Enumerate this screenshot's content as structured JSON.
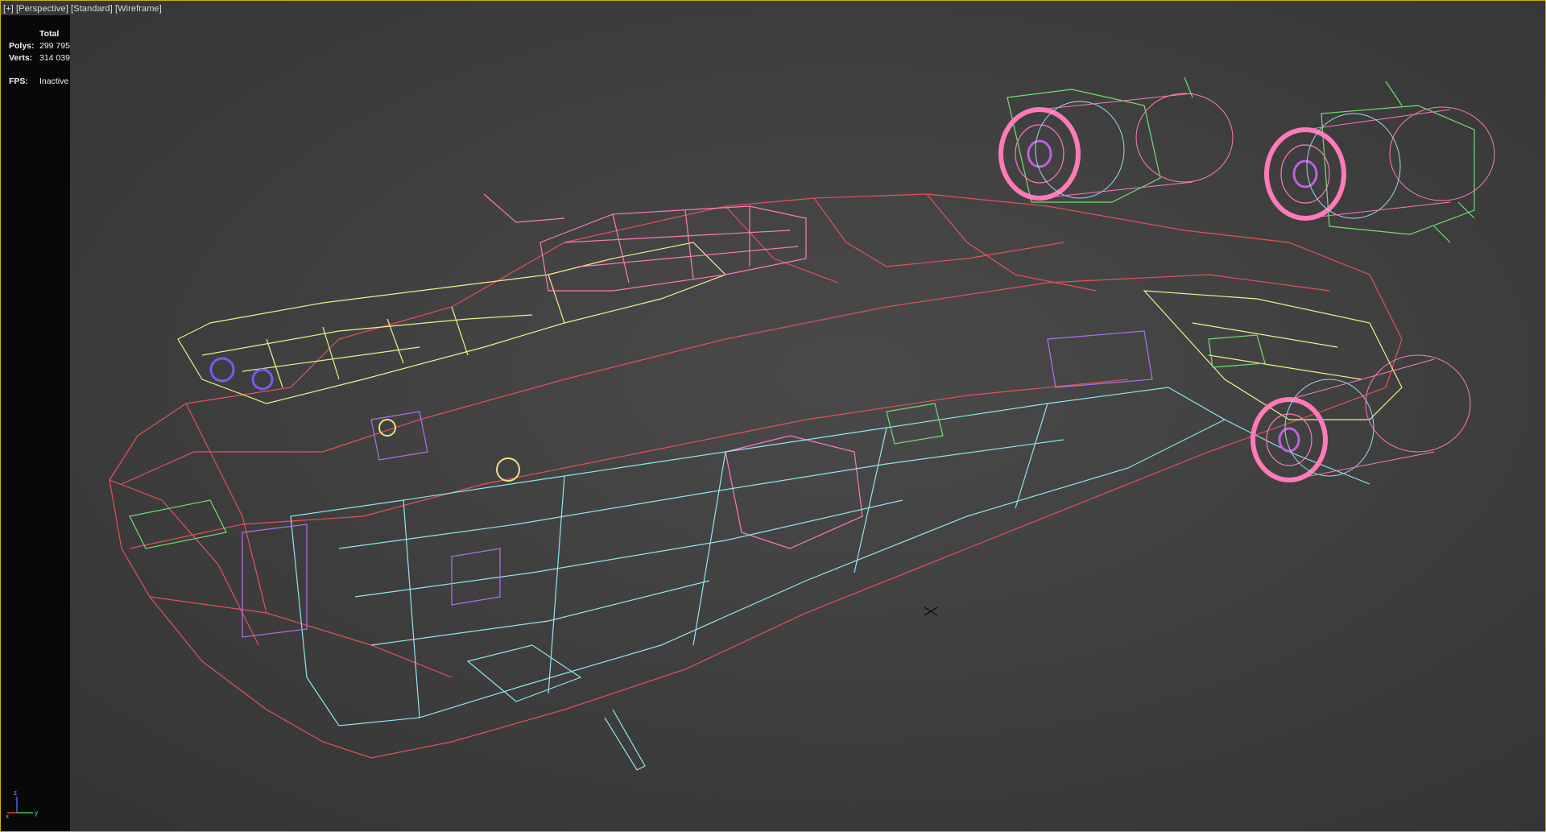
{
  "viewport": {
    "labels": {
      "plus": "[+]",
      "view": "[Perspective]",
      "shading": "[Standard]",
      "mode": "[Wireframe]"
    },
    "stats": {
      "header": "Total",
      "polys_label": "Polys:",
      "polys_value": "299 795",
      "verts_label": "Verts:",
      "verts_value": "314 039",
      "fps_label": "FPS:",
      "fps_value": "Inactive"
    },
    "axis_gizmo": {
      "x": "x",
      "y": "y",
      "z": "z"
    },
    "colors": {
      "border_active": "#c8b400",
      "background": "#3d3d3d",
      "wire_red": "#e8505a",
      "wire_pink": "#ff7ab8",
      "wire_yellow": "#f0f08c",
      "wire_cyan": "#8fe6f0",
      "wire_violet": "#b070f0",
      "wire_green": "#70e070"
    },
    "icons": [
      "pivot-cross-icon",
      "axis-gizmo-icon"
    ]
  }
}
